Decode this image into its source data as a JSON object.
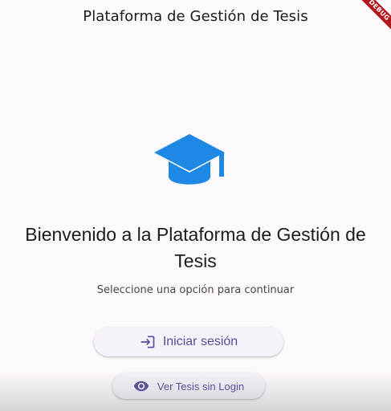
{
  "app_bar": {
    "title": "Plataforma de Gestión de Tesis"
  },
  "debug_banner": {
    "label": "DEBUG"
  },
  "hero": {
    "icon": "school-icon",
    "icon_color": "#1e88e5"
  },
  "welcome": {
    "title_line1": "Bienvenido a la Plataforma de Gestión de",
    "title_line2": "Tesis",
    "subtitle": "Seleccione una opción para continuar"
  },
  "actions": {
    "login": {
      "label": "Iniciar sesión",
      "icon": "login-icon"
    },
    "guest": {
      "label": "Ver Tesis sin Login",
      "icon": "eye-icon"
    },
    "button_text_color": "#5b4b9c"
  }
}
